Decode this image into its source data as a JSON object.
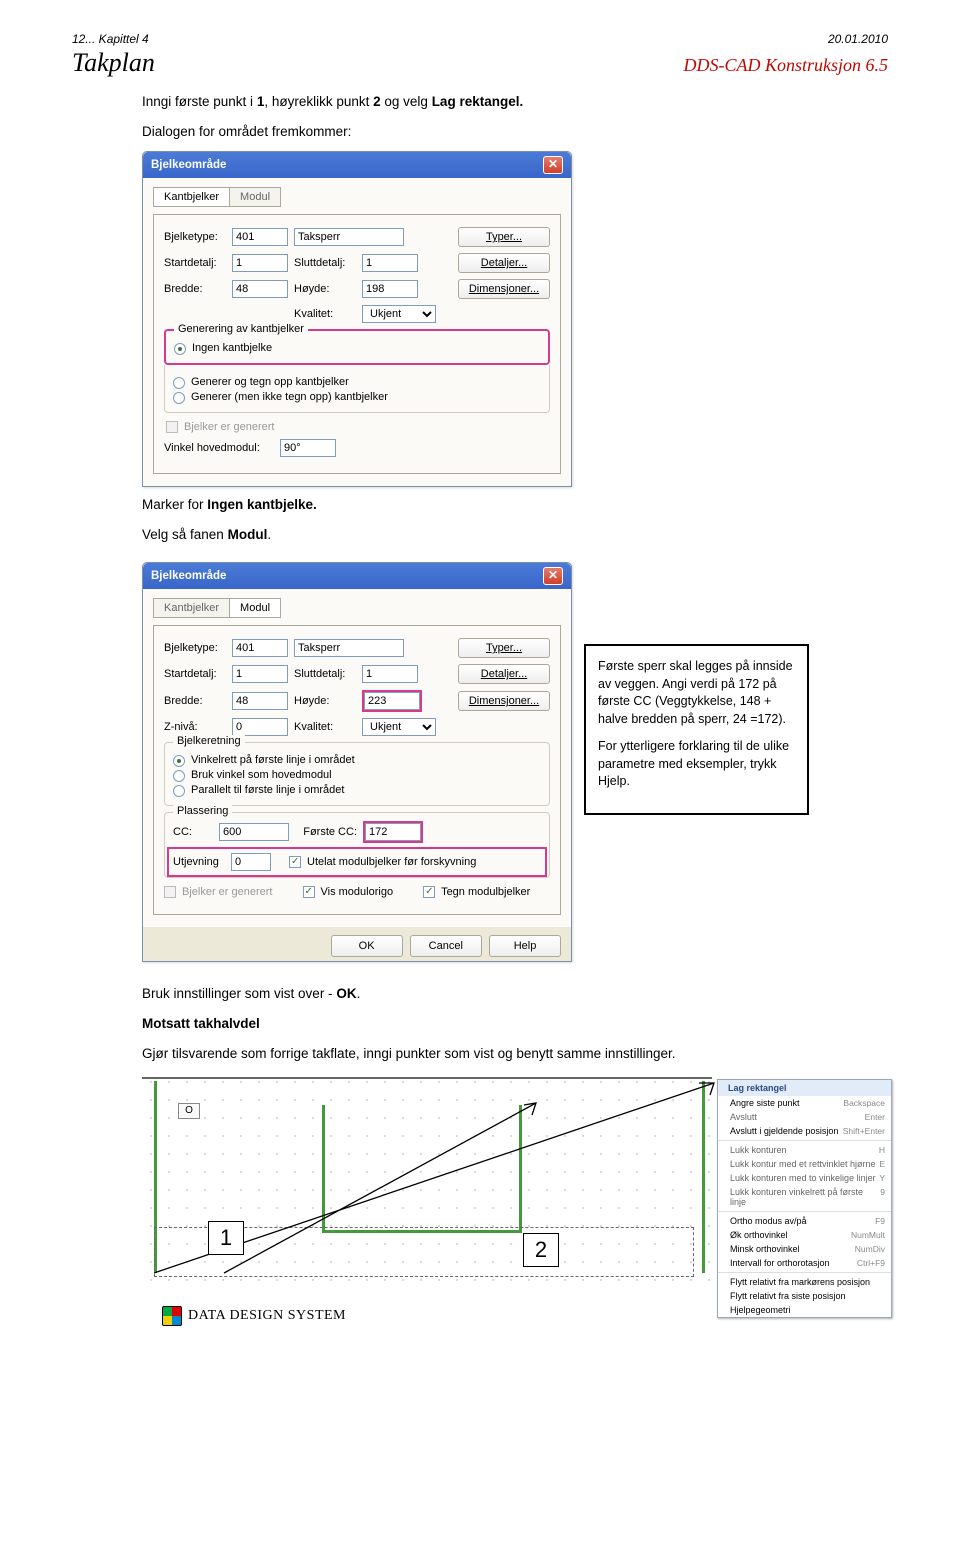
{
  "header": {
    "left": "12... Kapittel 4",
    "right": "20.01.2010",
    "title": "Takplan",
    "product": "DDS-CAD Konstruksjon 6.5"
  },
  "intro": {
    "p1_a": "Inngi første punkt i ",
    "p1_b": "1",
    "p1_c": ", høyreklikk punkt ",
    "p1_d": "2",
    "p1_e": " og velg ",
    "p1_f": "Lag rektangel.",
    "p2": "Dialogen for området fremkommer:"
  },
  "dlg1": {
    "title": "Bjelkeområde",
    "tab1": "Kantbjelker",
    "tab2": "Modul",
    "l_bjelketype": "Bjelketype:",
    "v_bjelketype": "401",
    "l_taksperr": "Taksperr",
    "btn_typer": "Typer...",
    "l_startdetalj": "Startdetalj:",
    "v_start": "1",
    "l_sluttdetalj": "Sluttdetalj:",
    "v_slutt": "1",
    "btn_detaljer": "Detaljer...",
    "l_bredde": "Bredde:",
    "v_bredde": "48",
    "l_hoyde": "Høyde:",
    "v_hoyde": "198",
    "btn_dim": "Dimensjoner...",
    "l_kvalitet": "Kvalitet:",
    "v_kvalitet": "Ukjent",
    "gb_title": "Generering av kantbjelker",
    "opt1": "Ingen kantbjelke",
    "opt2": "Generer og tegn opp kantbjelker",
    "opt3": "Generer (men ikke tegn opp) kantbjelker",
    "chk1": "Bjelker er generert",
    "l_vinkel": "Vinkel hovedmodul:",
    "v_vinkel": "90°"
  },
  "mid": {
    "p1_a": "Marker for ",
    "p1_b": "Ingen kantbjelke.",
    "p2_a": "Velg så fanen ",
    "p2_b": "Modul",
    "p2_c": "."
  },
  "dlg2": {
    "title": "Bjelkeområde",
    "tab1": "Kantbjelker",
    "tab2": "Modul",
    "l_bjelketype": "Bjelketype:",
    "v_bjelketype": "401",
    "l_taksperr": "Taksperr",
    "btn_typer": "Typer...",
    "l_startdetalj": "Startdetalj:",
    "v_start": "1",
    "l_sluttdetalj": "Sluttdetalj:",
    "v_slutt": "1",
    "btn_detaljer": "Detaljer...",
    "l_bredde": "Bredde:",
    "v_bredde": "48",
    "l_hoyde": "Høyde:",
    "v_hoyde": "223",
    "btn_dim": "Dimensjoner...",
    "l_zniva": "Z-nivå:",
    "v_zniva": "0",
    "l_kvalitet": "Kvalitet:",
    "v_kvalitet": "Ukjent",
    "gb1_title": "Bjelkeretning",
    "gb1_o1": "Vinkelrett på første linje i området",
    "gb1_o2": "Bruk vinkel som hovedmodul",
    "gb1_o3": "Parallelt til første linje i området",
    "gb2_title": "Plassering",
    "l_cc": "CC:",
    "v_cc": "600",
    "l_firstcc": "Første CC:",
    "v_firstcc": "172",
    "l_utj": "Utjevning",
    "v_utj": "0",
    "chk_utelat": "Utelat modulbjelker før forskyvning",
    "chk_gen": "Bjelker er generert",
    "chk_vis": "Vis modulorigo",
    "chk_tegn": "Tegn modulbjelker",
    "ok": "OK",
    "cancel": "Cancel",
    "help": "Help"
  },
  "sidenote": {
    "p1": "Første sperr skal legges på innside av veggen. Angi verdi på 172 på første CC (Veggtykkelse, 148 + halve bredden på sperr, 24 =172).",
    "p2": "For ytterligere forklaring til de ulike parametre med eksempler, trykk Hjelp."
  },
  "after": {
    "p1_a": "Bruk innstillinger som vist over - ",
    "p1_b": "OK",
    "h": "Motsatt takhalvdel",
    "p2": "Gjør tilsvarende som forrige takflate, inngi punkter som vist og benytt samme innstillinger."
  },
  "diagram": {
    "o": "O",
    "n1": "1",
    "n2": "2"
  },
  "menu": {
    "top": "Lag rektangel",
    "items": [
      [
        "Angre siste punkt",
        "Backspace",
        true
      ],
      [
        "Avslutt",
        "Enter",
        false
      ],
      [
        "Avslutt i gjeldende posisjon",
        "Shift+Enter",
        true
      ],
      [
        "-",
        "",
        false
      ],
      [
        "Lukk konturen",
        "H",
        false
      ],
      [
        "Lukk kontur med et rettvinklet hjørne",
        "E",
        false
      ],
      [
        "Lukk konturen med to vinkelige linjer",
        "Y",
        false
      ],
      [
        "Lukk konturen vinkelrett på første linje",
        "9",
        false
      ],
      [
        "-",
        "",
        false
      ],
      [
        "Ortho modus av/på",
        "F9",
        true
      ],
      [
        "Øk orthovinkel",
        "NumMult",
        true
      ],
      [
        "Minsk orthovinkel",
        "NumDiv",
        true
      ],
      [
        "Intervall for orthorotasjon",
        "Ctrl+F9",
        true
      ],
      [
        "-",
        "",
        false
      ],
      [
        "Flytt relativt fra markørens posisjon",
        "",
        true
      ],
      [
        "Flytt relativt fra siste posisjon",
        "",
        true
      ],
      [
        "Hjelpegeometri",
        "",
        true
      ]
    ]
  },
  "footer": {
    "brand": "DATA DESIGN SYSTEM"
  }
}
